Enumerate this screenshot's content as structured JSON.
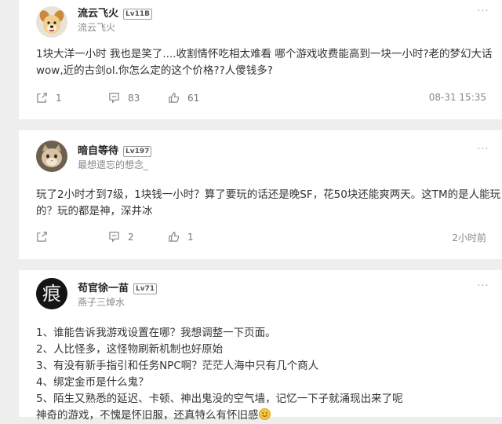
{
  "comments": [
    {
      "username": "流云飞火",
      "level": "Lv11B",
      "signature": "流云飞火",
      "lines": [
        "1块大洋一小时 我也是笑了....收割情怀吃相太难看 哪个游戏收费能高到一块一小时?老的梦幻大话",
        "wow,近的古剑ol.你怎么定的这个价格??人傻钱多?"
      ],
      "share_count": "1",
      "reply_count": "83",
      "like_count": "61",
      "time": "08-31 15:35",
      "avatar": "dog-avatar"
    },
    {
      "username": "暗自等待",
      "level": "Lv197",
      "signature": "最想遗忘的想念_",
      "lines": [
        "玩了2小时才到7级，1块钱一小时？算了要玩的话还是晚SF，花50块还能爽两天。这TM的是人能玩",
        "的？玩的都是神，深井冰"
      ],
      "share_count": "",
      "reply_count": "2",
      "like_count": "1",
      "time": "2小时前",
      "avatar": "cat-avatar"
    },
    {
      "username": "苟官徐一苗",
      "level": "Lv71",
      "signature": "燕子三焯水",
      "lines": [
        "1、谁能告诉我游戏设置在哪？我想调整一下页面。",
        "2、人比怪多，这怪物刷新机制也好原始",
        "3、有没有新手指引和任务NPC啊？茫茫人海中只有几个商人",
        "4、绑定金币是什么鬼？",
        "5、陌生又熟悉的延迟、卡顿、神出鬼没的空气墙，记忆一下子就涌现出来了呢",
        "神奇的游戏，不愧是怀旧服，还真特么有怀旧感"
      ],
      "avatar": "calligraphy-avatar",
      "avatar_char": "痕"
    }
  ]
}
